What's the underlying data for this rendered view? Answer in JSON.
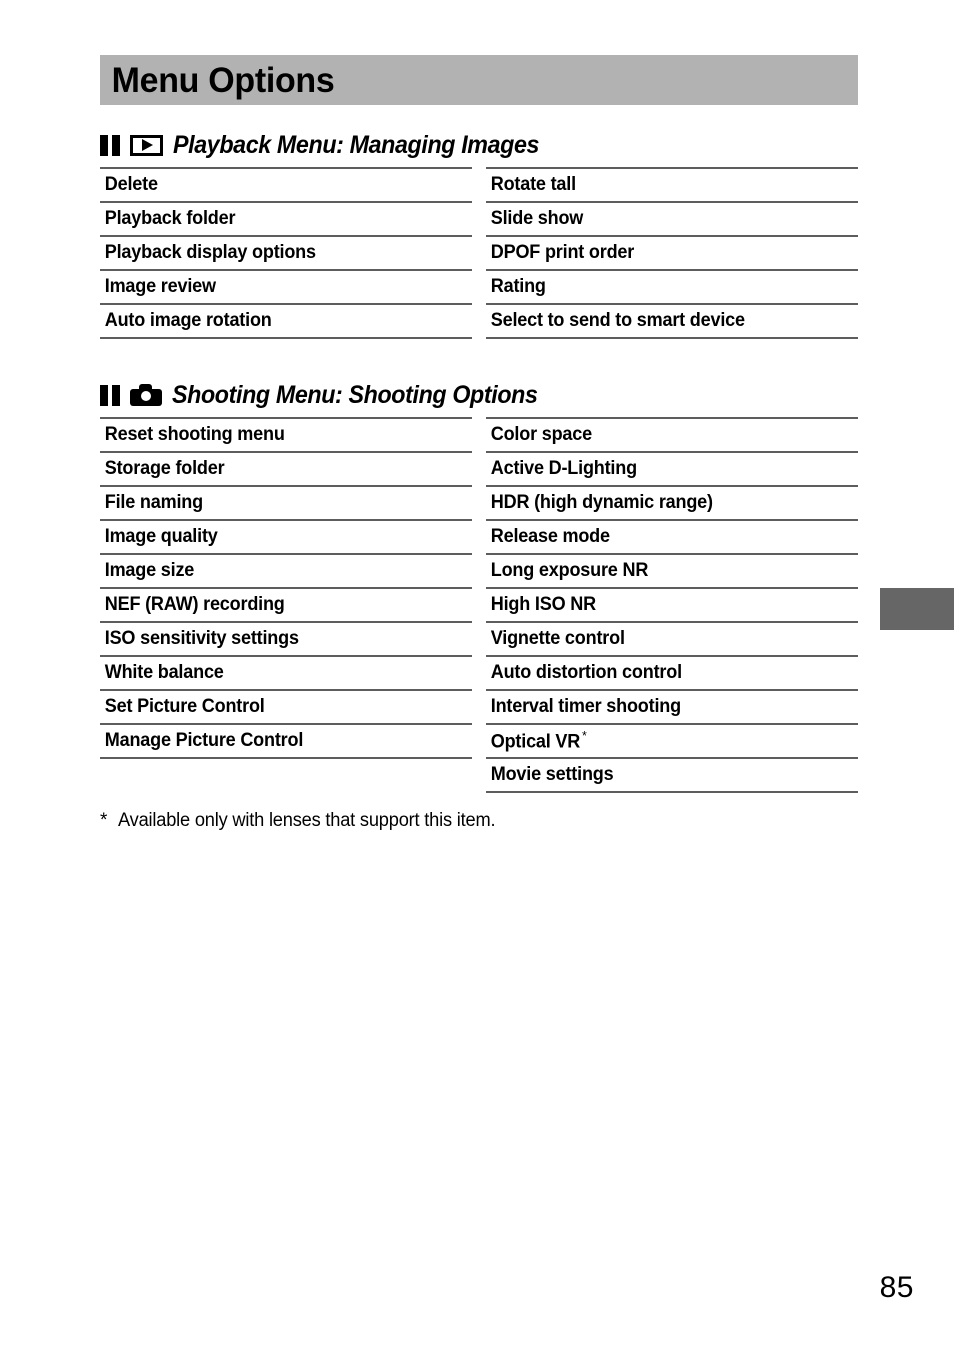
{
  "page": {
    "title": "Menu Options",
    "page_number": "85",
    "edge_tab_color": "#666666",
    "title_bar_color": "#b2b2b2",
    "rule_color": "#5d5d5d"
  },
  "sections": [
    {
      "icon_bars": "two-bars-icon",
      "icon_main": "playback-icon",
      "heading": "Playback Menu: Managing Images",
      "left_items": [
        "Delete",
        "Playback folder",
        "Playback display options",
        "Image review",
        "Auto image rotation"
      ],
      "right_items": [
        "Rotate tall",
        "Slide show",
        "DPOF print order",
        "Rating",
        "Select to send to smart device"
      ]
    },
    {
      "icon_bars": "two-bars-icon",
      "icon_main": "camera-icon",
      "heading": "Shooting Menu: Shooting Options",
      "left_items": [
        "Reset shooting menu",
        "Storage folder",
        "File naming",
        "Image quality",
        "Image size",
        "NEF (RAW) recording",
        "ISO sensitivity settings",
        "White balance",
        "Set Picture Control",
        "Manage Picture Control"
      ],
      "right_items": [
        "Color space",
        "Active D-Lighting",
        "HDR (high dynamic range)",
        "Release mode",
        "Long exposure NR",
        "High ISO NR",
        "Vignette control",
        "Auto distortion control",
        "Interval timer shooting",
        "Optical VR",
        "Movie settings"
      ],
      "right_items_superscript": {
        "9": "*"
      }
    }
  ],
  "footnote": {
    "mark": "*",
    "text": "Available only with lenses that support this item."
  }
}
